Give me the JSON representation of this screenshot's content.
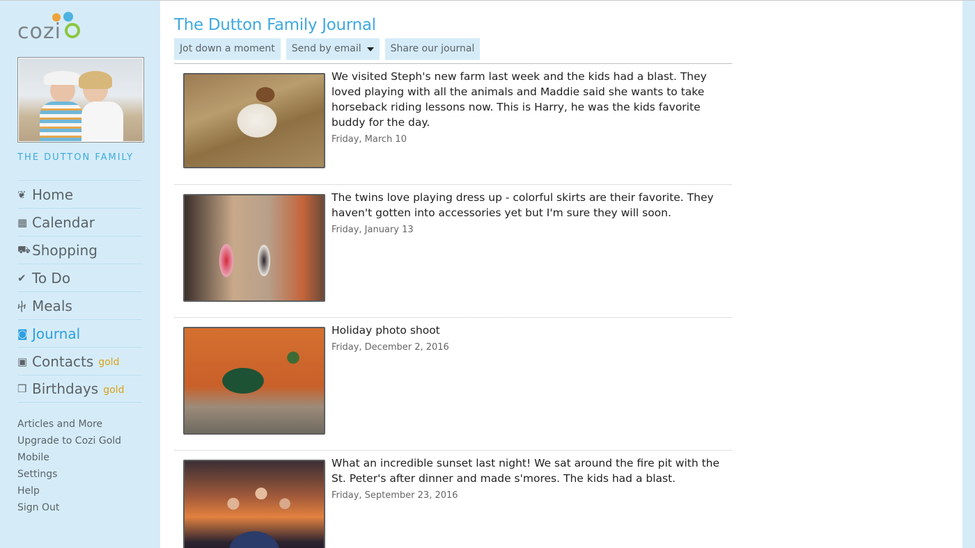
{
  "brand": {
    "logo_text": "cozi",
    "colors": {
      "accent": "#3fa9df",
      "sidebar_bg": "#d5ecf8",
      "gold_badge": "#d9a21b",
      "logo_orange": "#f0a33a",
      "logo_blue": "#4eb3e0",
      "logo_green": "#8cc63f"
    }
  },
  "sidebar": {
    "family_photo_icon": "family-photo",
    "family_name": "THE DUTTON FAMILY",
    "nav": [
      {
        "label": "Home",
        "icon": "home-icon",
        "glyph": "❦",
        "active": false,
        "badge": ""
      },
      {
        "label": "Calendar",
        "icon": "calendar-icon",
        "glyph": "▦",
        "active": false,
        "badge": ""
      },
      {
        "label": "Shopping",
        "icon": "cart-icon",
        "glyph": "⛟",
        "active": false,
        "badge": ""
      },
      {
        "label": "To Do",
        "icon": "check-icon",
        "glyph": "✔",
        "active": false,
        "badge": ""
      },
      {
        "label": "Meals",
        "icon": "utensils-icon",
        "glyph": "ⴕ",
        "active": false,
        "badge": ""
      },
      {
        "label": "Journal",
        "icon": "camera-icon",
        "glyph": "◙",
        "active": true,
        "badge": ""
      },
      {
        "label": "Contacts",
        "icon": "address-book-icon",
        "glyph": "▣",
        "active": false,
        "badge": "gold"
      },
      {
        "label": "Birthdays",
        "icon": "gift-icon",
        "glyph": "❒",
        "active": false,
        "badge": "gold"
      }
    ],
    "links": [
      "Articles and More",
      "Upgrade to Cozi Gold",
      "Mobile",
      "Settings",
      "Help",
      "Sign Out"
    ]
  },
  "main": {
    "title": "The Dutton Family Journal",
    "toolbar": {
      "jot_label": "Jot down a moment",
      "email_label": "Send by email",
      "share_label": "Share our journal"
    },
    "entries": [
      {
        "text": "We visited Steph's new farm last week and the kids had a blast. They loved playing with all the animals and Maddie said she wants to take horseback riding lessons now. This is Harry, he was the kids favorite buddy for the day.",
        "date": "Friday, March 10",
        "photo": "dog-photo"
      },
      {
        "text": "The twins love playing dress up - colorful skirts are their favorite. They haven't gotten into accessories yet but I'm sure they will soon.",
        "date": "Friday, January 13",
        "photo": "twins-photo"
      },
      {
        "text": "Holiday photo shoot",
        "date": "Friday, December 2, 2016",
        "photo": "horse-photo"
      },
      {
        "text": "What an incredible sunset last night! We sat around the fire pit with the St. Peter's after dinner and made s'mores. The kids had a blast.",
        "date": "Friday, September 23, 2016",
        "photo": "sunset-photo"
      }
    ]
  }
}
